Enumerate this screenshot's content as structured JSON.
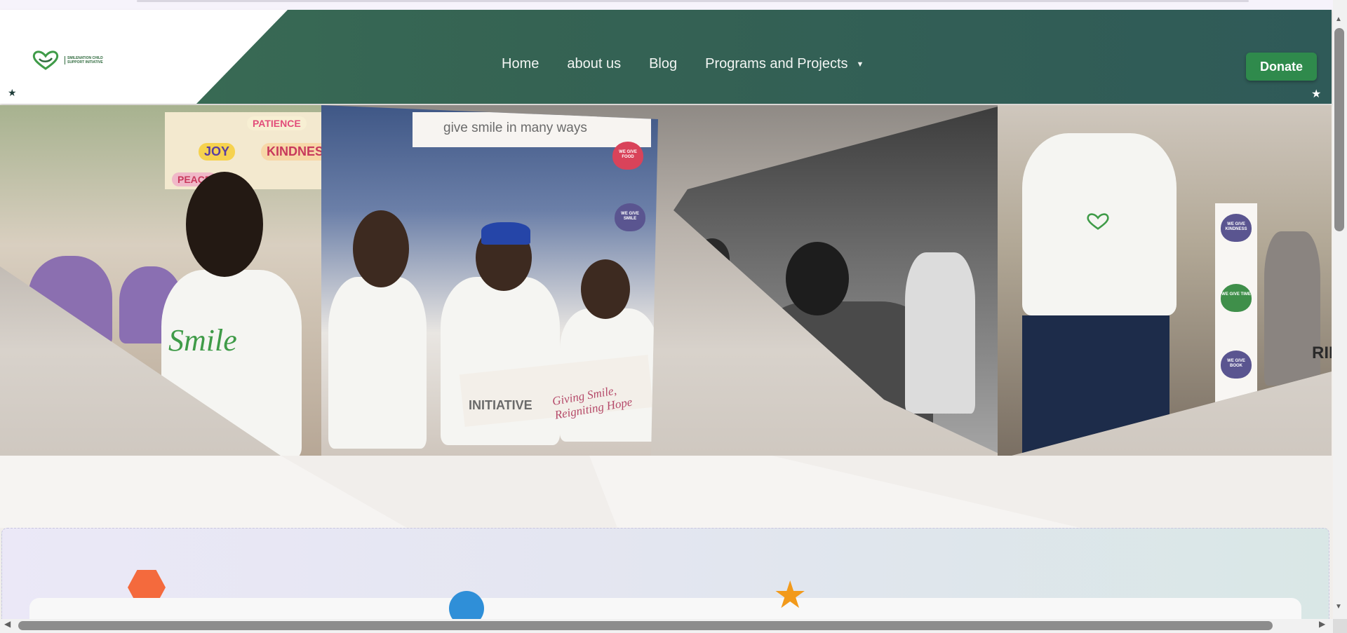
{
  "header": {
    "logo": {
      "name": "SMILENATION CHILD SUPPORT INITIATIVE",
      "tagline": "Giving Smile, Reigniting Hope"
    },
    "nav": [
      {
        "label": "Home"
      },
      {
        "label": "about us"
      },
      {
        "label": "Blog"
      },
      {
        "label": "Programs and Projects",
        "has_dropdown": true
      }
    ],
    "donate_label": "Donate",
    "star_glyph": "★",
    "colors": {
      "header_green": "#356353",
      "donate_green": "#2f8a4c"
    }
  },
  "hero": {
    "board_words": [
      "PATIENCE",
      "JOY",
      "KINDNESS",
      "PEACE"
    ],
    "sign_text": "give smile in many ways",
    "banner_text": "INITIATIVE",
    "banner_script": "Giving Smile, Reigniting Hope",
    "shirt_text": "Smile",
    "hearts_left": [
      "WE GIVE FOOD",
      "WE GIVE SMILE"
    ],
    "hearts_right": [
      "WE GIVE KINDNESS",
      "WE GIVE TIME",
      "WE GIVE BOOK"
    ],
    "right_edge_text": "RID"
  },
  "lower": {
    "shapes": [
      {
        "name": "hexagon",
        "color": "#f46a3d"
      },
      {
        "name": "circle",
        "color": "#2f8fd8"
      },
      {
        "name": "star",
        "color": "#f29a1b",
        "glyph": "★"
      }
    ]
  },
  "scrollbars": {
    "vertical_up": "▲",
    "vertical_down": "▼",
    "horizontal_left": "◀",
    "horizontal_right": "▶"
  }
}
